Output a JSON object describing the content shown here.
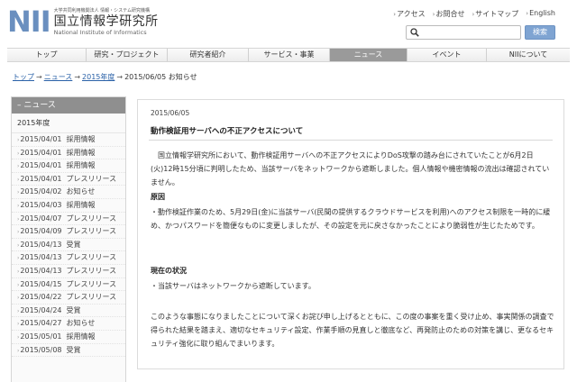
{
  "logo": {
    "mark": "NII",
    "small": "大学共同利用機関法人 情報・システム研究機構",
    "jp": "国立情報学研究所",
    "en": "National Institute of Informatics"
  },
  "util_links": [
    "アクセス",
    "お問合せ",
    "サイトマップ",
    "English"
  ],
  "search": {
    "button": "検索",
    "placeholder": ""
  },
  "nav": [
    "トップ",
    "研究・プロジェクト",
    "研究者紹介",
    "サービス・事業",
    "ニュース",
    "イベント",
    "NIIについて"
  ],
  "breadcrumb": [
    "トップ",
    "ニュース",
    "2015年度",
    "2015/06/05 お知らせ"
  ],
  "sidebar": {
    "heading": "ニュース",
    "year": "2015年度",
    "items": [
      {
        "date": "2015/04/01",
        "cat": "採用情報"
      },
      {
        "date": "2015/04/01",
        "cat": "採用情報"
      },
      {
        "date": "2015/04/01",
        "cat": "採用情報"
      },
      {
        "date": "2015/04/01",
        "cat": "プレスリリース"
      },
      {
        "date": "2015/04/02",
        "cat": "お知らせ"
      },
      {
        "date": "2015/04/03",
        "cat": "採用情報"
      },
      {
        "date": "2015/04/07",
        "cat": "プレスリリース"
      },
      {
        "date": "2015/04/09",
        "cat": "プレスリリース"
      },
      {
        "date": "2015/04/13",
        "cat": "受賞"
      },
      {
        "date": "2015/04/13",
        "cat": "プレスリリース"
      },
      {
        "date": "2015/04/13",
        "cat": "プレスリリース"
      },
      {
        "date": "2015/04/15",
        "cat": "プレスリリース"
      },
      {
        "date": "2015/04/22",
        "cat": "プレスリリース"
      },
      {
        "date": "2015/04/24",
        "cat": "受賞"
      },
      {
        "date": "2015/04/27",
        "cat": "お知らせ"
      },
      {
        "date": "2015/05/01",
        "cat": "採用情報"
      },
      {
        "date": "2015/05/08",
        "cat": "受賞"
      }
    ]
  },
  "article": {
    "date": "2015/06/05",
    "title": "動作検証用サーバへの不正アクセスについて",
    "intro": "国立情報学研究所において、動作検証用サーバへの不正アクセスによりDoS攻撃の踏み台にされていたことが6月2日(火)12時15分頃に判明したため、当該サーバをネットワークから遮断しました。個人情報や機密情報の流出は確認されていません。",
    "cause_heading": "原因",
    "cause": "・動作検証作業のため、5月29日(金)に当該サーバ(民間の提供するクラウドサービスを利用)へのアクセス制限を一時的に緩め、かつパスワードを簡便なものに変更しましたが、その設定を元に戻さなかったことにより脆弱性が生じたためです。",
    "status_heading": "現在の状況",
    "status": "・当該サーバはネットワークから遮断しています。",
    "closing": "このような事態になりましたことについて深くお詫び申し上げるとともに、この度の事案を重く受け止め、事実関係の調査で得られた結果を踏まえ、適切なセキュリティ設定、作業手順の見直しと徹底など、再発防止のための対策を講じ、更なるセキュリティ強化に取り組んでまいります。"
  }
}
